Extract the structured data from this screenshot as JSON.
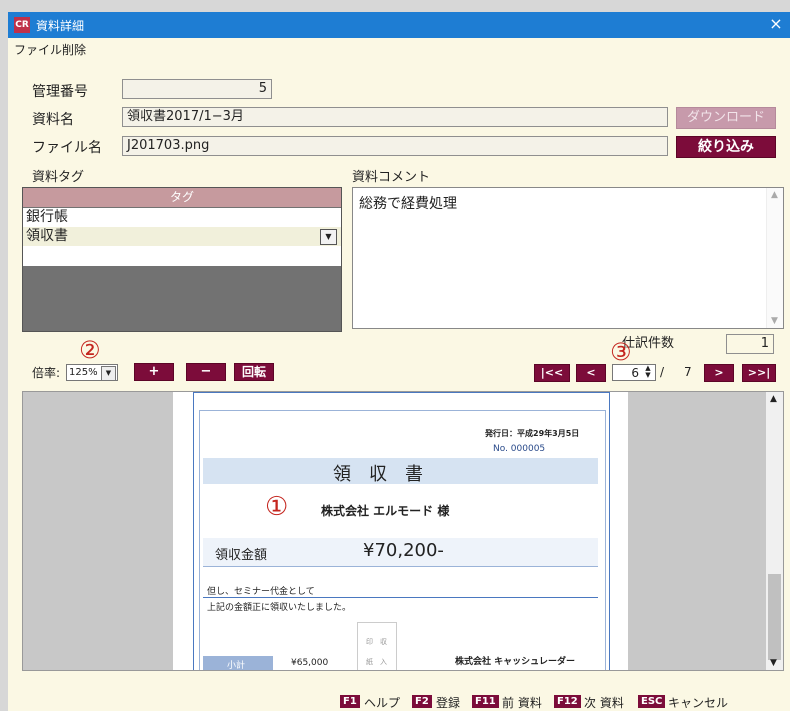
{
  "window": {
    "title": "資料詳細",
    "app_logo": "CR",
    "close_glyph": "×"
  },
  "menu": {
    "file_delete": "ファイル削除"
  },
  "form": {
    "mgmt_no_label": "管理番号",
    "mgmt_no_value": "5",
    "doc_name_label": "資料名",
    "doc_name_value": "領収書2017/1−3月",
    "file_name_label": "ファイル名",
    "file_name_value": "J201703.png",
    "download_label": "ダウンロード",
    "filter_label": "絞り込み",
    "tags_label": "資料タグ",
    "comment_label": "資料コメント",
    "comment_value": "総務で経費処理"
  },
  "tags": {
    "header": "タグ",
    "rows": [
      "銀行帳",
      "領収書"
    ]
  },
  "journal": {
    "label": "仕訳件数",
    "count": "1"
  },
  "viewer": {
    "zoom_label": "倍率:",
    "zoom_value": "125%",
    "plus": "+",
    "minus": "−",
    "rotate": "回転",
    "first": "|<<",
    "prev": "<",
    "next": ">",
    "last": ">>|",
    "page_current": "6",
    "page_sep": "/",
    "page_total": "7",
    "marker_1": "①",
    "marker_2": "②",
    "marker_3": "③"
  },
  "receipt": {
    "issue_date": "発行日：平成29年3月5日",
    "number": "No. 000005",
    "title": "領　収　書",
    "addressee": "株式会社 エルモード 様",
    "amount_label": "領収金額",
    "amount": "¥70,200-",
    "note": "但し、セミナー代金として",
    "confirm": "上記の金額正に領収いたしました。",
    "stamp_top": "印　収",
    "stamp_bottom": "紙　入",
    "subtotal_label": "小計",
    "subtotal": "¥65,000",
    "issuer": "株式会社 キャッシュレーダー"
  },
  "statusbar": [
    {
      "key": "F1",
      "label": "ヘルプ"
    },
    {
      "key": "F2",
      "label": "登録"
    },
    {
      "key": "F11",
      "label": "前 資料"
    },
    {
      "key": "F12",
      "label": "次 資料"
    },
    {
      "key": "ESC",
      "label": "キャンセル"
    }
  ],
  "colors": {
    "titlebar": "#1e7dd3",
    "accent": "#7c0c3a",
    "window_bg": "#fbf8e4",
    "marker": "#c4261f"
  }
}
